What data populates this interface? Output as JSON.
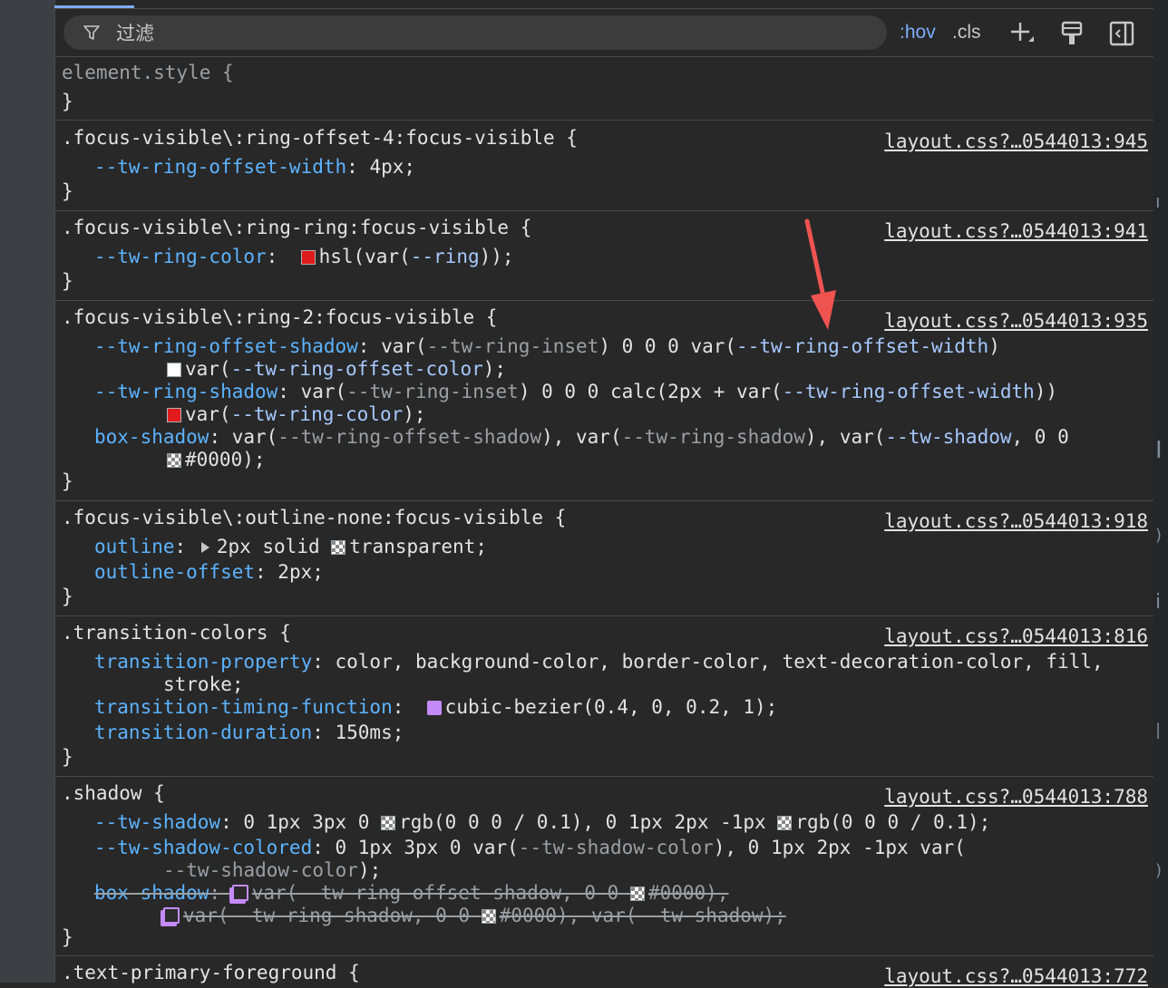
{
  "toolbar": {
    "filter_placeholder": "过滤",
    "hov": ":hov",
    "cls": ".cls"
  },
  "rules": {
    "element_style": {
      "selector": "element.style {",
      "close": "}"
    },
    "r945": {
      "selector": ".focus-visible\\:ring-offset-4:focus-visible {",
      "source": "layout.css?…0544013:945",
      "p1": "--tw-ring-offset-width",
      "v1": ": 4px;",
      "close": "}"
    },
    "r941": {
      "selector": ".focus-visible\\:ring-ring:focus-visible {",
      "source": "layout.css?…0544013:941",
      "p1": "--tw-ring-color",
      "v1": "hsl(var(",
      "v1b": "--ring",
      "v1c": "));",
      "close": "}"
    },
    "r935": {
      "selector": ".focus-visible\\:ring-2:focus-visible {",
      "source": "layout.css?…0544013:935",
      "p1": "--tw-ring-offset-shadow",
      "close": "}"
    },
    "r918": {
      "selector": ".focus-visible\\:outline-none:focus-visible {",
      "source": "layout.css?…0544013:918",
      "p1": "outline",
      "v1a": "2px solid ",
      "v1b": "transparent;",
      "p2": "outline-offset",
      "v2": ": 2px;",
      "close": "}"
    },
    "r816": {
      "selector": ".transition-colors {",
      "source": "layout.css?…0544013:816",
      "p1": "transition-property",
      "v1": ": color, background-color, border-color, text-decoration-color, fill,",
      "v1cont": "stroke;",
      "p2": "transition-timing-function",
      "v2": "cubic-bezier(0.4, 0, 0.2, 1);",
      "p3": "transition-duration",
      "v3": ": 150ms;",
      "close": "}"
    },
    "r788": {
      "selector": ".shadow {",
      "source": "layout.css?…0544013:788",
      "close": "}"
    },
    "r772": {
      "selector": ".text-primary-foreground {",
      "source": "layout.css?…0544013:772"
    }
  }
}
